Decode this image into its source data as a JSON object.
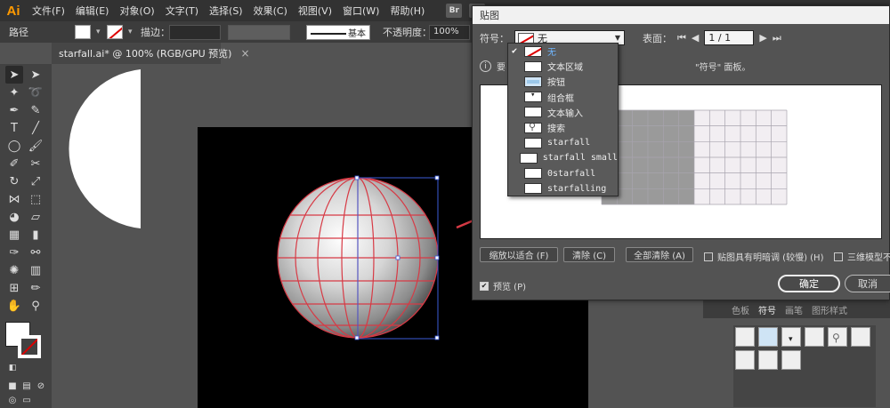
{
  "app": {
    "logo": "Ai"
  },
  "menu": [
    "文件(F)",
    "编辑(E)",
    "对象(O)",
    "文字(T)",
    "选择(S)",
    "效果(C)",
    "视图(V)",
    "窗口(W)",
    "帮助(H)"
  ],
  "menu_apps": [
    "Br",
    "St"
  ],
  "control_bar": {
    "selection_label": "路径",
    "stroke_label": "描边：",
    "stroke_style": "基本",
    "opacity_label": "不透明度：",
    "opacity_value": "100%"
  },
  "document_tab": {
    "title": "starfall.ai* @ 100% (RGB/GPU 预览)",
    "close": "×"
  },
  "toolbar": {
    "tools": [
      "selection-icon",
      "direct-selection-icon",
      "magic-wand-icon",
      "lasso-icon",
      "pen-icon",
      "curvature-icon",
      "type-icon",
      "line-icon",
      "ellipse-icon",
      "paintbrush-icon",
      "shaper-icon",
      "scissors-icon",
      "rotate-icon",
      "scale-icon",
      "width-icon",
      "free-transform-icon",
      "shape-builder-icon",
      "perspective-icon",
      "mesh-icon",
      "gradient-icon",
      "eyedropper-icon",
      "blend-icon",
      "symbol-sprayer-icon",
      "graph-icon",
      "artboard-icon",
      "slice-icon",
      "hand-icon",
      "zoom-icon"
    ]
  },
  "dialog": {
    "title": "贴图",
    "symbol_label": "符号：",
    "symbol_value": "无",
    "surface_label": "表面：",
    "surface_value": "1 / 1",
    "info_text_left": "要",
    "info_text_right": "\"符号\" 面板。",
    "buttons": {
      "scale_to_fit": "缩放以适合 (F)",
      "clear": "清除 (C)",
      "clear_all": "全部清除 (A)",
      "ok": "确定",
      "cancel": "取消"
    },
    "shaded_artwork_label": "贴图具有明暗调 (较慢) (H)",
    "shaded_artwork_checked": false,
    "invisible_geometry_label": "三维模型不可见 (V)",
    "invisible_geometry_checked": false,
    "preview_label": "预览 (P)",
    "preview_checked": true
  },
  "symbol_dropdown": {
    "items": [
      {
        "label": "无",
        "selected": true,
        "thumb": "none"
      },
      {
        "label": "文本区域",
        "selected": false,
        "thumb": "blank"
      },
      {
        "label": "按钮",
        "selected": false,
        "thumb": "btn"
      },
      {
        "label": "组合框",
        "selected": false,
        "thumb": "combo"
      },
      {
        "label": "文本输入",
        "selected": false,
        "thumb": "blank"
      },
      {
        "label": "搜索",
        "selected": false,
        "thumb": "search"
      },
      {
        "label": "starfall",
        "selected": false,
        "thumb": "blank"
      },
      {
        "label": "starfall small",
        "selected": false,
        "thumb": "blank"
      },
      {
        "label": "0starfall",
        "selected": false,
        "thumb": "blank"
      },
      {
        "label": "starfalling",
        "selected": false,
        "thumb": "blank"
      }
    ]
  },
  "symbols_panel": {
    "tabs": [
      "色板",
      "符号",
      "画笔",
      "图形样式"
    ]
  },
  "colors": {
    "accent_red": "#d73a45",
    "selection_blue": "#3b5bd8",
    "artboard": "#000000",
    "ui_dark": "#323232",
    "ui_mid": "#535353"
  }
}
